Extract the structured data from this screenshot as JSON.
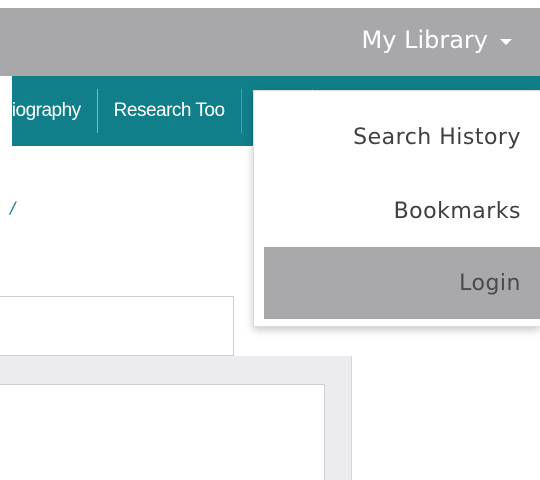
{
  "header": {
    "library_label": "My Library"
  },
  "nav": {
    "items": [
      {
        "label": "bliography"
      },
      {
        "label": "Research Too"
      }
    ]
  },
  "content": {
    "link_fragment": "/"
  },
  "dropdown": {
    "items": [
      {
        "label": "Search History"
      },
      {
        "label": "Bookmarks"
      },
      {
        "label": "Login",
        "highlighted": true
      }
    ]
  },
  "colors": {
    "header_grey": "#a8a8ab",
    "nav_teal": "#117f8a",
    "menu_highlight": "#a9a9ac",
    "menu_text": "#404040"
  }
}
